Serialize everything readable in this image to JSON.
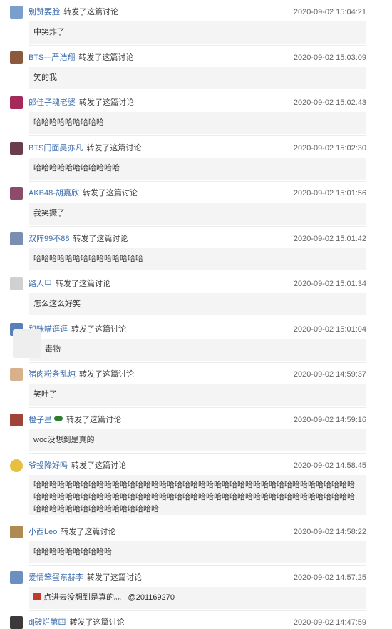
{
  "action_text": "转发了这篇讨论",
  "items": [
    {
      "user": "别赞要脸",
      "time": "2020-09-02 15:04:21",
      "content": "中笑炸了",
      "avatar_color": "#7a9fcf"
    },
    {
      "user": "BTS—严浩翔",
      "time": "2020-09-02 15:03:09",
      "content": "笑的我",
      "avatar_color": "#8b5a3c"
    },
    {
      "user": "郎佳子魂老婆",
      "time": "2020-09-02 15:02:43",
      "content": "哈哈哈哈哈哈哈哈哈",
      "avatar_color": "#a52a5a"
    },
    {
      "user": "BTS门面吴亦凡",
      "time": "2020-09-02 15:02:30",
      "content": "哈哈哈哈哈哈哈哈哈哈哈",
      "avatar_color": "#6b3b4e"
    },
    {
      "user": "AKB48-胡嘉欣",
      "time": "2020-09-02 15:01:56",
      "content": "我笑撅了",
      "avatar_color": "#8d4a6a"
    },
    {
      "user": "双阵99不88",
      "time": "2020-09-02 15:01:42",
      "content": "哈哈哈哈哈哈哈哈哈哈哈哈哈哈",
      "avatar_color": "#7a8fb0"
    },
    {
      "user": "路人甲",
      "time": "2020-09-02 15:01:34",
      "content": "怎么这么好笑",
      "avatar_color": "#d0d0d0"
    },
    {
      "user": "和咪喵逛逛",
      "time": "2020-09-02 15:01:04",
      "content": "毒物",
      "avatar_color": "#5a7fb8"
    },
    {
      "user": "猪肉粉条乱炖",
      "time": "2020-09-02 14:59:37",
      "content": "笑吐了",
      "avatar_color": "#d8b08a"
    },
    {
      "user": "橙子星",
      "time": "2020-09-02 14:59:16",
      "content": "woc没想到是真的",
      "avatar_color": "#a0443a"
    },
    {
      "user": "爷投降好吗",
      "time": "2020-09-02 14:58:45",
      "content": "哈哈哈哈哈哈哈哈哈哈哈哈哈哈哈哈哈哈哈哈哈哈哈哈哈哈哈哈哈哈哈哈哈哈哈哈哈哈哈哈哈哈哈哈哈哈哈哈哈哈哈哈哈哈哈哈哈哈哈哈哈哈哈哈哈哈哈哈哈哈哈哈哈哈哈哈哈哈哈哈哈哈哈哈哈哈哈哈哈哈哈哈哈哈哈哈哈哈",
      "avatar_color": "#e8c040"
    },
    {
      "user": "小西Leo",
      "time": "2020-09-02 14:58:22",
      "content": "哈哈哈哈哈哈哈哈哈哈",
      "avatar_color": "#b08a50"
    },
    {
      "user": "爱情笨蛋东赫李",
      "time": "2020-09-02 14:57:25",
      "content": "点进去没想到是真的。。 @201169270",
      "avatar_color": "#6a8fc0"
    },
    {
      "user": "dj破烂第四",
      "time": "2020-09-02 14:47:59",
      "content": "",
      "avatar_color": "#3a3a3a"
    }
  ]
}
